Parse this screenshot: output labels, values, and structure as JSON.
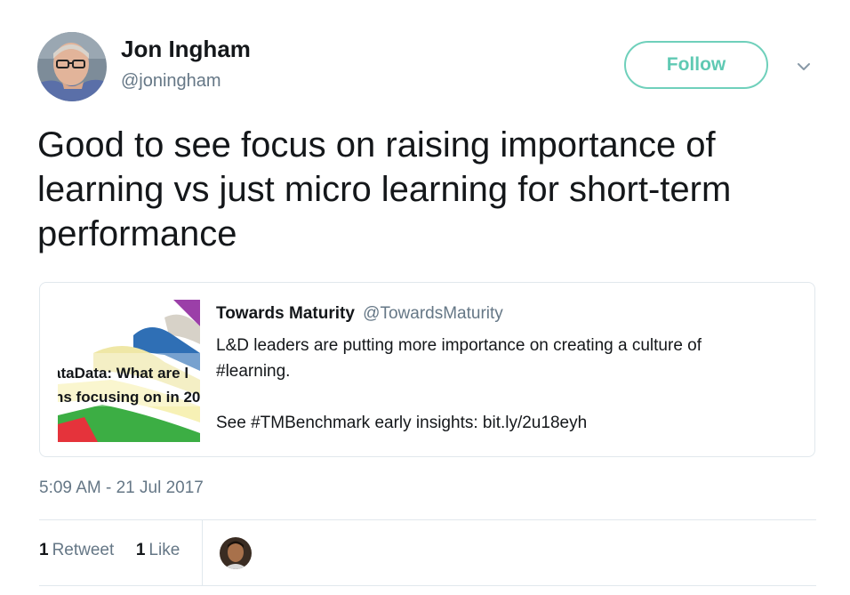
{
  "author": {
    "name": "Jon Ingham",
    "handle": "@joningham"
  },
  "follow_button": {
    "label": "Follow"
  },
  "tweet": {
    "text": "Good to see focus on raising importance of learning vs just micro learning for short-term performance",
    "timestamp": "5:09 AM - 21 Jul 2017"
  },
  "quoted_tweet": {
    "name": "Towards Maturity",
    "handle": "@TowardsMaturity",
    "line1": "L&D leaders are putting more importance on creating a culture of",
    "line2": "#learning.",
    "line3": "See #TMBenchmark early insights: bit.ly/2u18eyh",
    "thumbnail_text_line1": "ataData: What are l",
    "thumbnail_text_line2": "ns focusing on in 20"
  },
  "stats": {
    "retweet_count": "1",
    "retweet_label": "Retweet",
    "like_count": "1",
    "like_label": "Like"
  },
  "colors": {
    "follow_accent": "#5fc9b3",
    "secondary_text": "#657786",
    "border": "#e1e8ed"
  },
  "icons": {
    "more_menu": "chevron-down-icon"
  }
}
